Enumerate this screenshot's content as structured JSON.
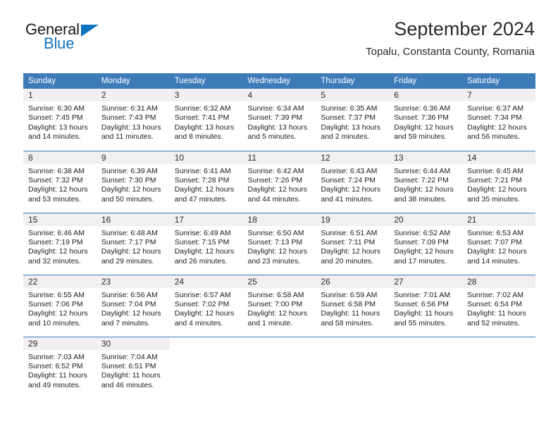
{
  "brand": {
    "name_part1": "General",
    "name_part2": "Blue",
    "accent_color": "#1173c0"
  },
  "header": {
    "title": "September 2024",
    "subtitle": "Topalu, Constanta County, Romania"
  },
  "theme": {
    "header_row_color": "#3e7cb9",
    "day_number_bg": "#f0f0f0",
    "text_color": "#1d1d1d"
  },
  "weekday_headers": [
    "Sunday",
    "Monday",
    "Tuesday",
    "Wednesday",
    "Thursday",
    "Friday",
    "Saturday"
  ],
  "weeks": [
    [
      {
        "day": "1",
        "sunrise": "Sunrise: 6:30 AM",
        "sunset": "Sunset: 7:45 PM",
        "daylight1": "Daylight: 13 hours",
        "daylight2": "and 14 minutes."
      },
      {
        "day": "2",
        "sunrise": "Sunrise: 6:31 AM",
        "sunset": "Sunset: 7:43 PM",
        "daylight1": "Daylight: 13 hours",
        "daylight2": "and 11 minutes."
      },
      {
        "day": "3",
        "sunrise": "Sunrise: 6:32 AM",
        "sunset": "Sunset: 7:41 PM",
        "daylight1": "Daylight: 13 hours",
        "daylight2": "and 8 minutes."
      },
      {
        "day": "4",
        "sunrise": "Sunrise: 6:34 AM",
        "sunset": "Sunset: 7:39 PM",
        "daylight1": "Daylight: 13 hours",
        "daylight2": "and 5 minutes."
      },
      {
        "day": "5",
        "sunrise": "Sunrise: 6:35 AM",
        "sunset": "Sunset: 7:37 PM",
        "daylight1": "Daylight: 13 hours",
        "daylight2": "and 2 minutes."
      },
      {
        "day": "6",
        "sunrise": "Sunrise: 6:36 AM",
        "sunset": "Sunset: 7:36 PM",
        "daylight1": "Daylight: 12 hours",
        "daylight2": "and 59 minutes."
      },
      {
        "day": "7",
        "sunrise": "Sunrise: 6:37 AM",
        "sunset": "Sunset: 7:34 PM",
        "daylight1": "Daylight: 12 hours",
        "daylight2": "and 56 minutes."
      }
    ],
    [
      {
        "day": "8",
        "sunrise": "Sunrise: 6:38 AM",
        "sunset": "Sunset: 7:32 PM",
        "daylight1": "Daylight: 12 hours",
        "daylight2": "and 53 minutes."
      },
      {
        "day": "9",
        "sunrise": "Sunrise: 6:39 AM",
        "sunset": "Sunset: 7:30 PM",
        "daylight1": "Daylight: 12 hours",
        "daylight2": "and 50 minutes."
      },
      {
        "day": "10",
        "sunrise": "Sunrise: 6:41 AM",
        "sunset": "Sunset: 7:28 PM",
        "daylight1": "Daylight: 12 hours",
        "daylight2": "and 47 minutes."
      },
      {
        "day": "11",
        "sunrise": "Sunrise: 6:42 AM",
        "sunset": "Sunset: 7:26 PM",
        "daylight1": "Daylight: 12 hours",
        "daylight2": "and 44 minutes."
      },
      {
        "day": "12",
        "sunrise": "Sunrise: 6:43 AM",
        "sunset": "Sunset: 7:24 PM",
        "daylight1": "Daylight: 12 hours",
        "daylight2": "and 41 minutes."
      },
      {
        "day": "13",
        "sunrise": "Sunrise: 6:44 AM",
        "sunset": "Sunset: 7:22 PM",
        "daylight1": "Daylight: 12 hours",
        "daylight2": "and 38 minutes."
      },
      {
        "day": "14",
        "sunrise": "Sunrise: 6:45 AM",
        "sunset": "Sunset: 7:21 PM",
        "daylight1": "Daylight: 12 hours",
        "daylight2": "and 35 minutes."
      }
    ],
    [
      {
        "day": "15",
        "sunrise": "Sunrise: 6:46 AM",
        "sunset": "Sunset: 7:19 PM",
        "daylight1": "Daylight: 12 hours",
        "daylight2": "and 32 minutes."
      },
      {
        "day": "16",
        "sunrise": "Sunrise: 6:48 AM",
        "sunset": "Sunset: 7:17 PM",
        "daylight1": "Daylight: 12 hours",
        "daylight2": "and 29 minutes."
      },
      {
        "day": "17",
        "sunrise": "Sunrise: 6:49 AM",
        "sunset": "Sunset: 7:15 PM",
        "daylight1": "Daylight: 12 hours",
        "daylight2": "and 26 minutes."
      },
      {
        "day": "18",
        "sunrise": "Sunrise: 6:50 AM",
        "sunset": "Sunset: 7:13 PM",
        "daylight1": "Daylight: 12 hours",
        "daylight2": "and 23 minutes."
      },
      {
        "day": "19",
        "sunrise": "Sunrise: 6:51 AM",
        "sunset": "Sunset: 7:11 PM",
        "daylight1": "Daylight: 12 hours",
        "daylight2": "and 20 minutes."
      },
      {
        "day": "20",
        "sunrise": "Sunrise: 6:52 AM",
        "sunset": "Sunset: 7:09 PM",
        "daylight1": "Daylight: 12 hours",
        "daylight2": "and 17 minutes."
      },
      {
        "day": "21",
        "sunrise": "Sunrise: 6:53 AM",
        "sunset": "Sunset: 7:07 PM",
        "daylight1": "Daylight: 12 hours",
        "daylight2": "and 14 minutes."
      }
    ],
    [
      {
        "day": "22",
        "sunrise": "Sunrise: 6:55 AM",
        "sunset": "Sunset: 7:06 PM",
        "daylight1": "Daylight: 12 hours",
        "daylight2": "and 10 minutes."
      },
      {
        "day": "23",
        "sunrise": "Sunrise: 6:56 AM",
        "sunset": "Sunset: 7:04 PM",
        "daylight1": "Daylight: 12 hours",
        "daylight2": "and 7 minutes."
      },
      {
        "day": "24",
        "sunrise": "Sunrise: 6:57 AM",
        "sunset": "Sunset: 7:02 PM",
        "daylight1": "Daylight: 12 hours",
        "daylight2": "and 4 minutes."
      },
      {
        "day": "25",
        "sunrise": "Sunrise: 6:58 AM",
        "sunset": "Sunset: 7:00 PM",
        "daylight1": "Daylight: 12 hours",
        "daylight2": "and 1 minute."
      },
      {
        "day": "26",
        "sunrise": "Sunrise: 6:59 AM",
        "sunset": "Sunset: 6:58 PM",
        "daylight1": "Daylight: 11 hours",
        "daylight2": "and 58 minutes."
      },
      {
        "day": "27",
        "sunrise": "Sunrise: 7:01 AM",
        "sunset": "Sunset: 6:56 PM",
        "daylight1": "Daylight: 11 hours",
        "daylight2": "and 55 minutes."
      },
      {
        "day": "28",
        "sunrise": "Sunrise: 7:02 AM",
        "sunset": "Sunset: 6:54 PM",
        "daylight1": "Daylight: 11 hours",
        "daylight2": "and 52 minutes."
      }
    ],
    [
      {
        "day": "29",
        "sunrise": "Sunrise: 7:03 AM",
        "sunset": "Sunset: 6:52 PM",
        "daylight1": "Daylight: 11 hours",
        "daylight2": "and 49 minutes."
      },
      {
        "day": "30",
        "sunrise": "Sunrise: 7:04 AM",
        "sunset": "Sunset: 6:51 PM",
        "daylight1": "Daylight: 11 hours",
        "daylight2": "and 46 minutes."
      },
      {
        "day": "",
        "sunrise": "",
        "sunset": "",
        "daylight1": "",
        "daylight2": ""
      },
      {
        "day": "",
        "sunrise": "",
        "sunset": "",
        "daylight1": "",
        "daylight2": ""
      },
      {
        "day": "",
        "sunrise": "",
        "sunset": "",
        "daylight1": "",
        "daylight2": ""
      },
      {
        "day": "",
        "sunrise": "",
        "sunset": "",
        "daylight1": "",
        "daylight2": ""
      },
      {
        "day": "",
        "sunrise": "",
        "sunset": "",
        "daylight1": "",
        "daylight2": ""
      }
    ]
  ]
}
